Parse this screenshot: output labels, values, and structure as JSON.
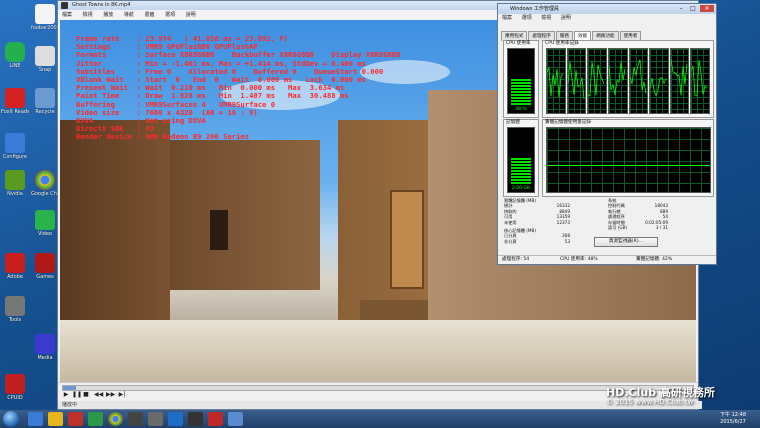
{
  "desktop_icons": [
    {
      "label": "LINE",
      "icon": "line-icon",
      "color": "#22b14c"
    },
    {
      "label": "Foxit Reader",
      "icon": "pdf-icon",
      "color": "#d42020"
    },
    {
      "label": "Configure",
      "icon": "config-icon",
      "color": "#3a7bd5"
    },
    {
      "label": "Nvidia",
      "icon": "nvidia-icon",
      "color": "#5a9a1e"
    },
    {
      "label": "Adobe",
      "icon": "adobe-icon",
      "color": "#c81e1e"
    },
    {
      "label": "Tools",
      "icon": "tools-icon",
      "color": "#888888"
    },
    {
      "label": "CPUID",
      "icon": "cpu-icon",
      "color": "#c02020"
    },
    {
      "label": "foobar2000",
      "icon": "foobar-icon",
      "color": "#ffffff"
    },
    {
      "label": "Snap",
      "icon": "snap-icon",
      "color": "#e0e0e0"
    },
    {
      "label": "Recycle",
      "icon": "recycle-icon",
      "color": "#6a9ad0"
    },
    {
      "label": "Google Chrome",
      "icon": "chrome-icon",
      "color": "#e8c21c"
    },
    {
      "label": "Video",
      "icon": "video-icon",
      "color": "#444444"
    },
    {
      "label": "Games",
      "icon": "game-icon",
      "color": "#b01818"
    },
    {
      "label": "Media",
      "icon": "media-icon",
      "color": "#3a3ad0"
    }
  ],
  "player": {
    "title": "Ghost Towns in 8K.mp4",
    "menu": [
      "檔案",
      "檢視",
      "播放",
      "導航",
      "書籤",
      "選項",
      "說明"
    ],
    "status_text": "播放中",
    "stats_lines": [
      "Frame rate    : 23.974   ( 41.858 ms = 23.892, P)",
      "Settings      : VMR9 GPUFlushBV GPUFlushAP",
      "Formats       : Surface X8R8G8B8    Backbuffer X8R8G8B8    Display X8R8G8B8",
      "Jitter        : Min = -1.401 ms, Max = +1.414 ms, StdDev = 0.406 ms",
      "Subtitles     : Free 0    Allocated 0    Buffered 0    QueueStart 0.000",
      "VBlank Wait   : Start  0   End  0   Wait  0.000 ms   Lock  0.000 ms",
      "Present Wait  : Wait  0.210 ms   Min  0.000 ms   Max  3.634 ms",
      "Paint Time    : Draw  1.828 ms   Min  1.407 ms   Max  30.488 ms",
      "Buffering     : VMR9Surfaces 4   VMR9Surface 0",
      "Video size    : 7680 x 4320  (AR = 16 : 9)",
      "DXVA          : Not using DXVA",
      "DirectX SDK   : 43",
      "Render device : AMD Radeon R9 200 Series"
    ],
    "controls": [
      "play",
      "pause",
      "stop",
      "prev",
      "next",
      "step"
    ],
    "seek_fraction": 0.02
  },
  "task_manager": {
    "title": "Windows 工作管理員",
    "menu": [
      "檔案",
      "選項",
      "檢視",
      "說明"
    ],
    "tabs": [
      "應用程式",
      "處理程序",
      "服務",
      "效能",
      "網路功能",
      "使用者"
    ],
    "active_tab": "效能",
    "cpu_usage_title": "CPU 使用率",
    "cpu_usage_value": "48 %",
    "cpu_history_title": "CPU 使用率記錄",
    "memory_title": "記憶體",
    "memory_value": "2.00 GB",
    "memory_history_title": "實體記憶體使用量記錄",
    "physical_memory": {
      "title": "實體記憶體 (MB)",
      "rows": [
        [
          "總計",
          "16332"
        ],
        [
          "快取的",
          "8849"
        ],
        [
          "可用",
          "13359"
        ],
        [
          "未使用",
          "12373"
        ]
      ]
    },
    "system": {
      "title": "系統",
      "rows": [
        [
          "控制代碼",
          "18043"
        ],
        [
          "執行緒",
          "889"
        ],
        [
          "處理程序",
          "54"
        ],
        [
          "存留時間",
          "0:02:05:09"
        ],
        [
          "認可 (GB)",
          "3 / 31"
        ]
      ]
    },
    "kernel_memory": {
      "title": "核心記憶體 (MB)",
      "rows": [
        [
          "已分頁",
          "308"
        ],
        [
          "非分頁",
          "53"
        ]
      ]
    },
    "resource_button": "資源監視器(R)...",
    "status": {
      "processes": "處理程序: 54",
      "cpu": "CPU 使用率: 48%",
      "memory": "實體記憶體: 42%"
    },
    "cpu_cores": 8,
    "accent": "#00ff00"
  },
  "taskbar": {
    "time": "下午 12:48",
    "date": "2015/6/27"
  },
  "watermark": {
    "line1": "HD.Club 高研視務所",
    "line2": "© 2015  www.HD.Club.tw"
  }
}
